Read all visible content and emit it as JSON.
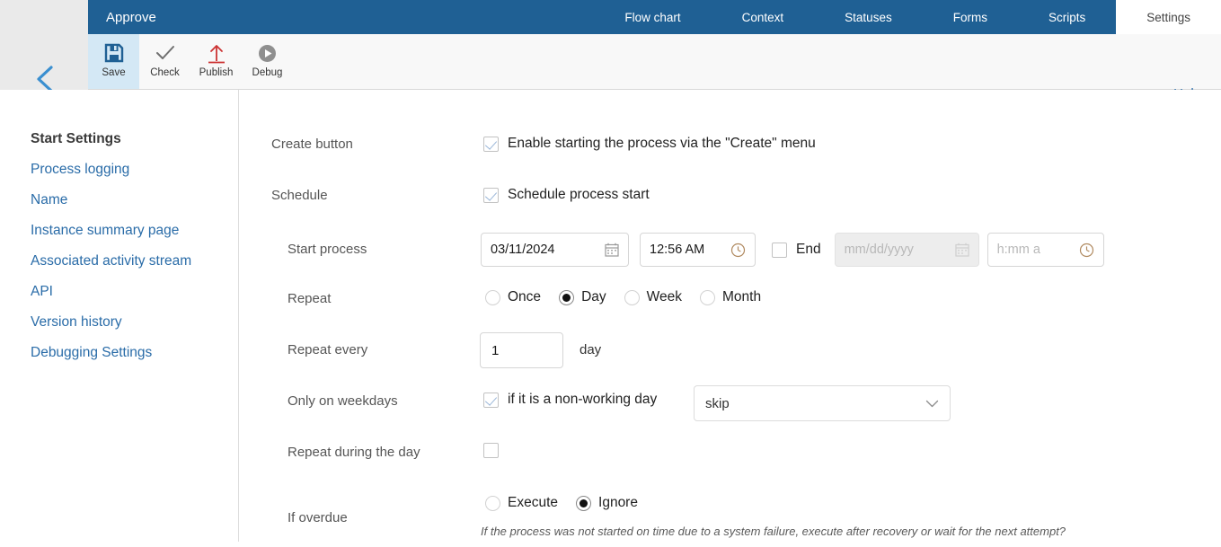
{
  "header": {
    "app_title": "Approve",
    "back_icon": "chevron-left-icon",
    "tabs": [
      {
        "label": "Flow chart",
        "active": false
      },
      {
        "label": "Context",
        "active": false
      },
      {
        "label": "Statuses",
        "active": false
      },
      {
        "label": "Forms",
        "active": false
      },
      {
        "label": "Scripts",
        "active": false
      },
      {
        "label": "Settings",
        "active": true
      }
    ],
    "accent_blue": "#1f6094",
    "tab_active_bg": "#ffffff"
  },
  "toolbar": {
    "items": [
      {
        "label": "Save",
        "icon": "floppy-disk-icon",
        "active": true
      },
      {
        "label": "Check",
        "icon": "checkmark-icon",
        "active": false
      },
      {
        "label": "Publish",
        "icon": "upload-arrow-icon",
        "active": false
      },
      {
        "label": "Debug",
        "icon": "play-circle-icon",
        "active": false
      }
    ],
    "help_label": "Help",
    "active_bg": "#d4e8f5"
  },
  "sidebar": {
    "items": [
      {
        "label": "Start Settings",
        "current": true
      },
      {
        "label": "Process logging",
        "current": false
      },
      {
        "label": "Name",
        "current": false
      },
      {
        "label": "Instance summary page",
        "current": false
      },
      {
        "label": "Associated activity stream",
        "current": false
      },
      {
        "label": "API",
        "current": false
      },
      {
        "label": "Version history",
        "current": false
      },
      {
        "label": "Debugging Settings",
        "current": false
      }
    ],
    "link_color": "#2a6ca8"
  },
  "form": {
    "create_button": {
      "label": "Create button",
      "checkbox_label": "Enable starting the process via the \"Create\" menu",
      "checked": true
    },
    "schedule": {
      "label": "Schedule",
      "checkbox_label": "Schedule process start",
      "checked": true
    },
    "start_process": {
      "label": "Start process",
      "date_value": "03/11/2024",
      "date_icon": "calendar-icon",
      "time_value": "12:56 AM",
      "time_icon": "clock-icon",
      "end_label": "End",
      "end_checked": false,
      "end_date_placeholder": "mm/dd/yyyy",
      "end_date_icon": "calendar-icon",
      "end_time_placeholder": "h:mm a",
      "end_time_icon": "clock-icon"
    },
    "repeat": {
      "label": "Repeat",
      "options": [
        {
          "label": "Once",
          "selected": false
        },
        {
          "label": "Day",
          "selected": true
        },
        {
          "label": "Week",
          "selected": false
        },
        {
          "label": "Month",
          "selected": false
        }
      ]
    },
    "repeat_every": {
      "label": "Repeat every",
      "value": "1",
      "unit": "day"
    },
    "only_weekdays": {
      "label": "Only on weekdays",
      "checkbox_label": "if it is a non-working day",
      "checked": true,
      "select_value": "skip",
      "select_icon": "chevron-down-icon"
    },
    "repeat_during_day": {
      "label": "Repeat during the day",
      "checked": false
    },
    "if_overdue": {
      "label": "If overdue",
      "options": [
        {
          "label": "Execute",
          "selected": false
        },
        {
          "label": "Ignore",
          "selected": true
        }
      ],
      "hint": "If the process was not started on time due to a system failure, execute after recovery or wait for the next attempt?"
    }
  }
}
